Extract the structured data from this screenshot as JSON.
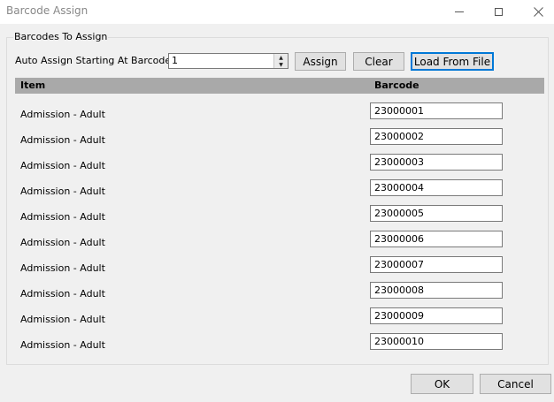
{
  "window": {
    "title": "Barcode Assign"
  },
  "group": {
    "label": "Barcodes To Assign"
  },
  "auto_assign": {
    "label": "Auto Assign Starting At Barcode #",
    "value": "1",
    "assign_label": "Assign",
    "clear_label": "Clear",
    "load_label": "Load From File"
  },
  "grid": {
    "headers": {
      "item": "Item",
      "barcode": "Barcode"
    },
    "rows": [
      {
        "item": "Admission - Adult",
        "barcode": "23000001"
      },
      {
        "item": "Admission - Adult",
        "barcode": "23000002"
      },
      {
        "item": "Admission - Adult",
        "barcode": "23000003"
      },
      {
        "item": "Admission - Adult",
        "barcode": "23000004"
      },
      {
        "item": "Admission - Adult",
        "barcode": "23000005"
      },
      {
        "item": "Admission - Adult",
        "barcode": "23000006"
      },
      {
        "item": "Admission - Adult",
        "barcode": "23000007"
      },
      {
        "item": "Admission - Adult",
        "barcode": "23000008"
      },
      {
        "item": "Admission - Adult",
        "barcode": "23000009"
      },
      {
        "item": "Admission - Adult",
        "barcode": "23000010"
      }
    ]
  },
  "footer": {
    "ok_label": "OK",
    "cancel_label": "Cancel"
  },
  "icons": {
    "minimize": "minimize-icon",
    "maximize": "maximize-icon",
    "close": "close-icon",
    "spin_up": "chevron-up-icon",
    "spin_down": "chevron-down-icon"
  },
  "colors": {
    "accent": "#0078d7",
    "header_bg": "#a9a9a9",
    "window_bg": "#f0f0f0"
  }
}
